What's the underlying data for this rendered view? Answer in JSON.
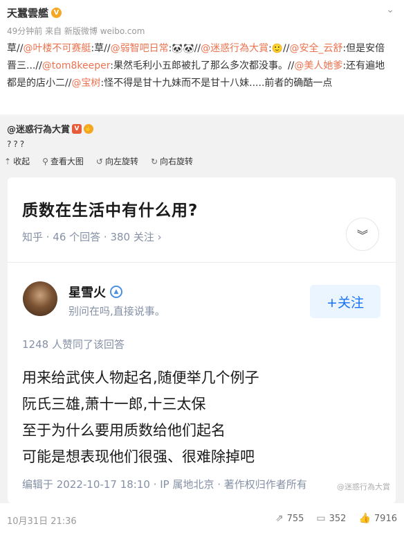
{
  "post": {
    "author": "天蠶雲艦",
    "verified_badge": "V",
    "meta": "49分钟前 来自 新版微博 weibo.com",
    "content": [
      {
        "t": "text",
        "v": "草//"
      },
      {
        "t": "mention",
        "v": "@叶楼不可赛艇"
      },
      {
        "t": "text",
        "v": ":草//"
      },
      {
        "t": "mention",
        "v": "@弱智吧日常"
      },
      {
        "t": "text",
        "v": ":"
      },
      {
        "t": "emoji",
        "v": "🐼🐼"
      },
      {
        "t": "text",
        "v": "//"
      },
      {
        "t": "mention",
        "v": "@迷惑行為大賞"
      },
      {
        "t": "text",
        "v": ":"
      },
      {
        "t": "emoji",
        "v": "🙂"
      },
      {
        "t": "text",
        "v": "//"
      },
      {
        "t": "mention",
        "v": "@安全_云舒"
      },
      {
        "t": "text",
        "v": ":但是安倍晋三...//"
      },
      {
        "t": "mention",
        "v": "@tom8keeper"
      },
      {
        "t": "text",
        "v": ":果然毛利小五郎被扎了那么多次都没事。//"
      },
      {
        "t": "mention",
        "v": "@美人她爹"
      },
      {
        "t": "text",
        "v": ":还有遍地都是的店小二//"
      },
      {
        "t": "mention",
        "v": "@宝树"
      },
      {
        "t": "text",
        "v": ":怪不得是甘十九妹而不是甘十八妹.....前者的确酷一点"
      }
    ]
  },
  "repost": {
    "author": "@迷惑行為大賞",
    "badge_v": "V",
    "badge_extra": "✋",
    "text": "???",
    "toolbar": {
      "collapse": "收起",
      "view_large": "查看大图",
      "rotate_left": "向左旋转",
      "rotate_right": "向右旋转"
    }
  },
  "zhihu": {
    "question": "质数在生活中有什么用?",
    "meta": "知乎 · 46 个回答 · 380 关注 ›",
    "answerer": "星雪火",
    "answerer_bio": "别问在吗,直接说事。",
    "follow": "+关注",
    "upvotes": "1248 人赞同了该回答",
    "answer_lines": [
      "用来给武侠人物起名,随便举几个例子",
      "阮氏三雄,萧十一郎,十三太保",
      "至于为什么要用质数给他们起名",
      "可能是想表现他们很强、很难除掉吧"
    ],
    "edit_info": "编辑于 2022-10-17 18:10 · IP 属地北京 · 著作权归作者所有",
    "watermark": "@迷惑行為大賞"
  },
  "footer": {
    "date": "10月31日 21:36",
    "reposts": "755",
    "comments": "352",
    "likes": "7916"
  }
}
